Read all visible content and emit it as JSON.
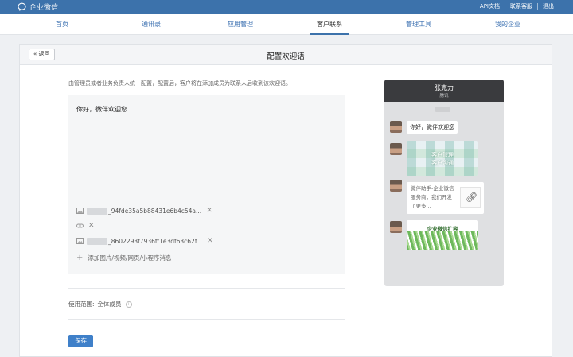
{
  "topbar": {
    "brand": "企业微信",
    "links": [
      "API文档",
      "联系客服",
      "退出"
    ]
  },
  "nav": {
    "items": [
      "首页",
      "通讯录",
      "应用管理",
      "客户联系",
      "管理工具",
      "我的企业"
    ],
    "active": "客户联系"
  },
  "page": {
    "back_label": "« 返回",
    "title": "配置欢迎语",
    "description": "由管理员或者业务负责人统一配置，配置后，客户将在添加成员为联系人后收到该欢迎语。"
  },
  "editor": {
    "text": "你好，微伴欢迎您",
    "attachments": [
      {
        "type": "image",
        "name": "_94fde35a5b88431e6b4c54a..."
      },
      {
        "type": "link",
        "name": ""
      },
      {
        "type": "image",
        "name": "_8602293f7936ff1e3df63c62f..."
      }
    ],
    "add_label": "添加图片/视频/网页/小程序消息"
  },
  "scope": {
    "label": "使用范围:",
    "value": "全体成员"
  },
  "save_label": "保存",
  "preview": {
    "contact_name": "张克力",
    "contact_org": "腾讯",
    "messages": [
      {
        "type": "text",
        "text": "你好，微伴欢迎您"
      },
      {
        "type": "image",
        "text_lines": [
          "客户管理",
          "客户沟通"
        ]
      },
      {
        "type": "link",
        "text": "微伴助手-企业微信服务商，我们开发了更多..."
      },
      {
        "type": "image",
        "text": "企业微信扩容"
      }
    ]
  },
  "colors": {
    "topbar": "#3c72ab",
    "nav_link": "#3a6fb0",
    "primary_button": "#3f80c9",
    "phone_header": "#3a3b3e"
  },
  "icons": {
    "brand": "chat-bubble-icon",
    "image_attachment": "image-icon",
    "link_attachment": "link-icon",
    "remove": "close-icon",
    "add": "plus-icon",
    "info": "info-icon"
  }
}
